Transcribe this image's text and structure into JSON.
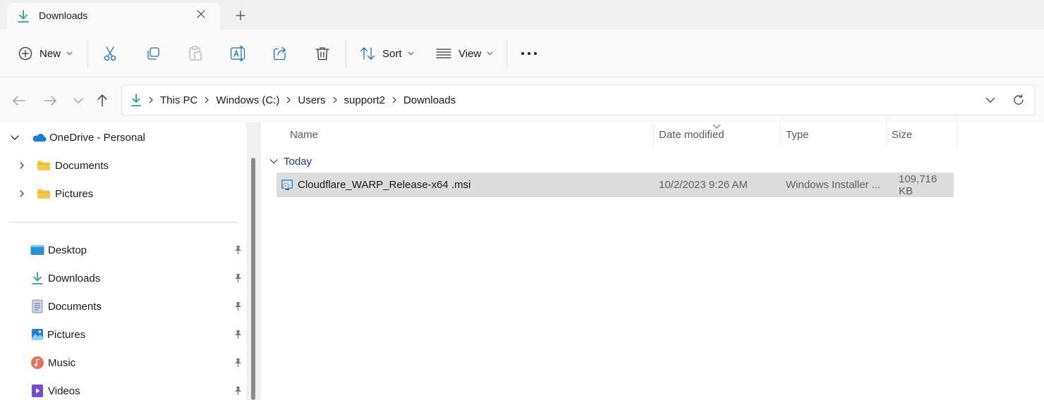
{
  "window": {
    "tab_title": "Downloads"
  },
  "colors": {
    "accent": "#2e9e8f",
    "selection": "#dcdcdc",
    "folder": "#f2c94c",
    "group_text": "#1f3b6d"
  },
  "toolbar": {
    "new_label": "New",
    "sort_label": "Sort",
    "view_label": "View",
    "icons": [
      "plus-circle-icon",
      "cut-icon",
      "copy-icon",
      "paste-icon",
      "rename-icon",
      "share-icon",
      "delete-icon",
      "sort-icon",
      "view-list-icon",
      "more-icon"
    ]
  },
  "address": {
    "crumbs": [
      "This PC",
      "Windows (C:)",
      "Users",
      "support2",
      "Downloads"
    ]
  },
  "sidebar": {
    "onedrive": {
      "label": "OneDrive - Personal",
      "children": [
        {
          "label": "Documents",
          "icon": "folder-icon"
        },
        {
          "label": "Pictures",
          "icon": "folder-icon"
        }
      ]
    },
    "quick_access": [
      {
        "label": "Desktop",
        "icon": "desktop-icon"
      },
      {
        "label": "Downloads",
        "icon": "download-icon"
      },
      {
        "label": "Documents",
        "icon": "document-icon"
      },
      {
        "label": "Pictures",
        "icon": "pictures-icon"
      },
      {
        "label": "Music",
        "icon": "music-icon"
      },
      {
        "label": "Videos",
        "icon": "videos-icon"
      }
    ]
  },
  "columns": {
    "name": "Name",
    "date": "Date modified",
    "type": "Type",
    "size": "Size"
  },
  "groups": [
    {
      "label": "Today",
      "files": [
        {
          "name": "Cloudflare_WARP_Release-x64 .msi",
          "date": "10/2/2023 9:26 AM",
          "type": "Windows Installer ...",
          "size": "109,716 KB"
        }
      ]
    }
  ]
}
